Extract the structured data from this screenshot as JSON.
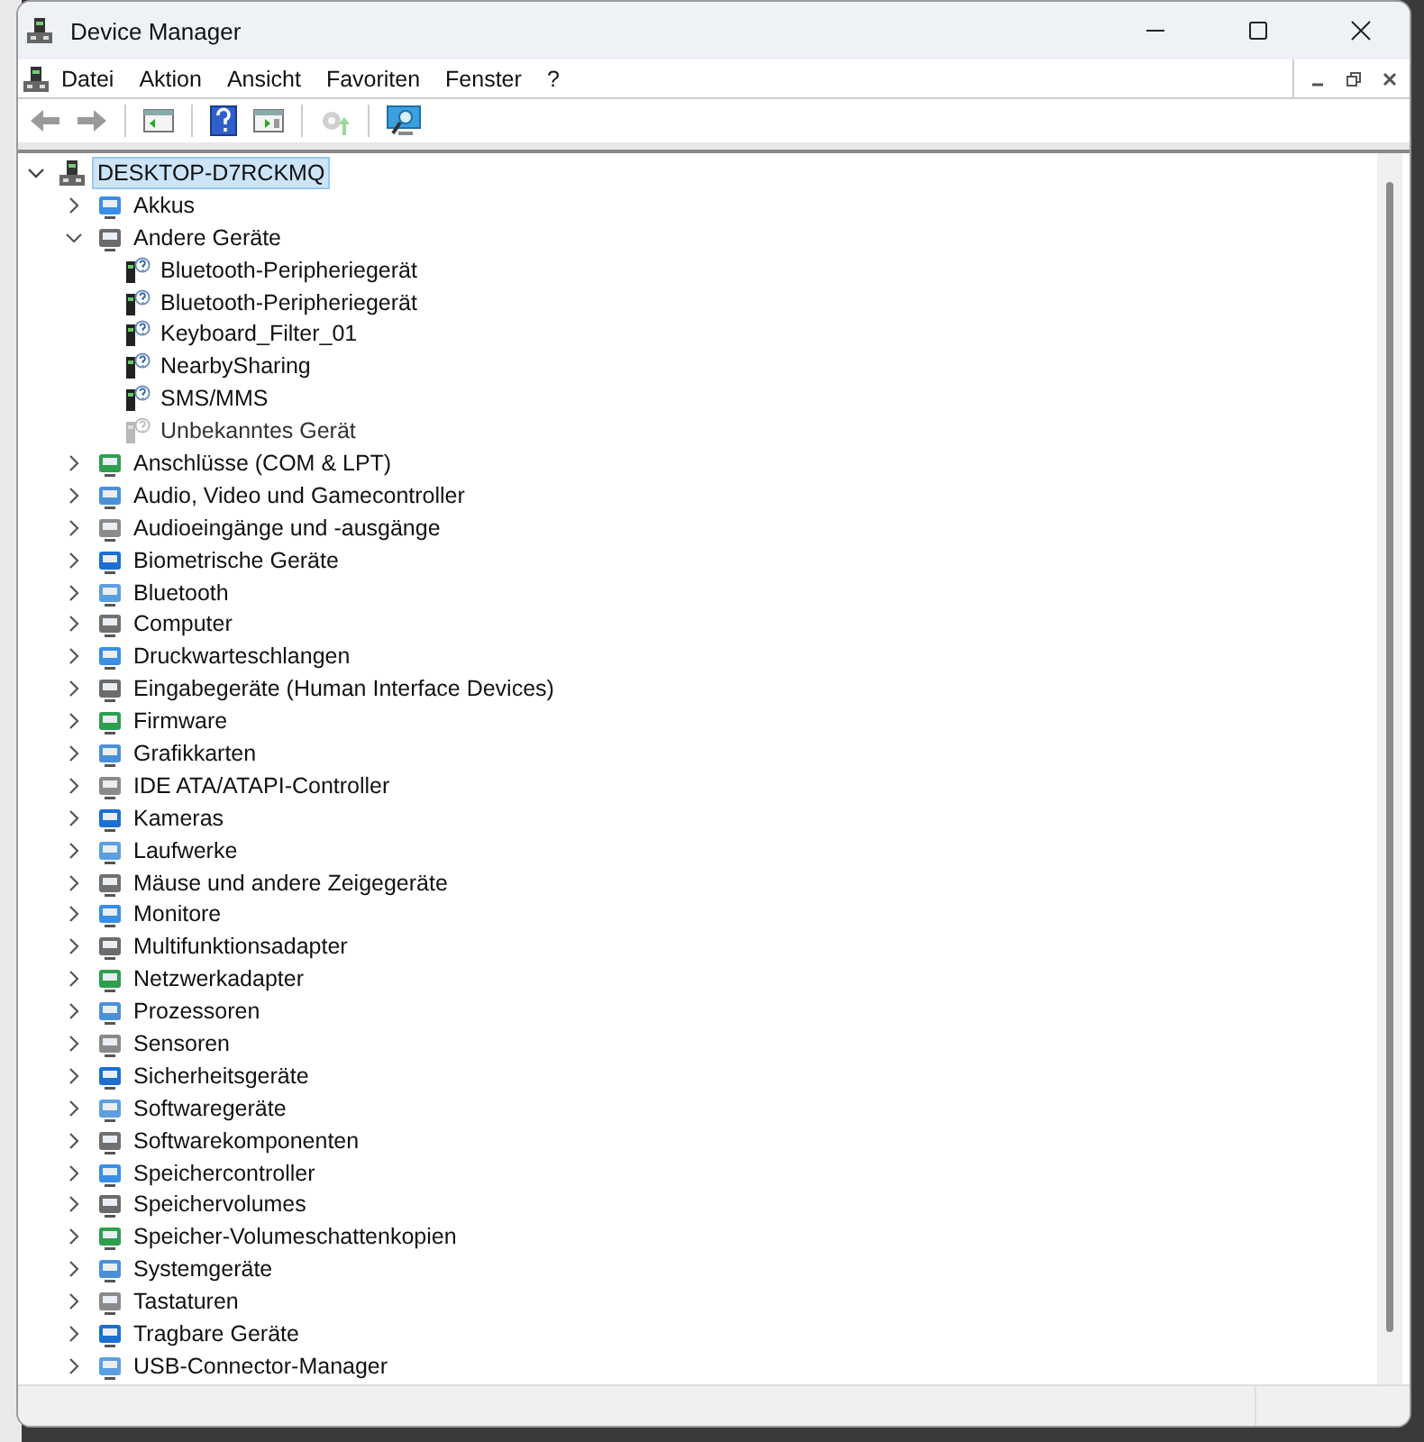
{
  "window": {
    "title": "Device Manager"
  },
  "menu": [
    {
      "label": "Datei"
    },
    {
      "label": "Aktion"
    },
    {
      "label": "Ansicht"
    },
    {
      "label": "Favoriten"
    },
    {
      "label": "Fenster"
    },
    {
      "label": "?"
    }
  ],
  "toolbar": [
    {
      "kind": "back",
      "disabled": true
    },
    {
      "kind": "forward",
      "disabled": true
    },
    {
      "kind": "panel",
      "disabled": false
    },
    {
      "kind": "help",
      "disabled": false
    },
    {
      "kind": "properties",
      "disabled": false
    },
    {
      "kind": "update",
      "disabled": true
    },
    {
      "kind": "scan",
      "disabled": false
    }
  ],
  "tree": {
    "label": "DESKTOP-D7RCKMQ",
    "expanded": true,
    "selected": true,
    "children": [
      {
        "label": "Akkus",
        "expanded": false
      },
      {
        "label": "Andere Geräte",
        "expanded": true,
        "children": [
          {
            "label": "Bluetooth-Peripheriegerät",
            "disabled": false
          },
          {
            "label": "Bluetooth-Peripheriegerät",
            "disabled": false
          },
          {
            "label": "Keyboard_Filter_01",
            "disabled": false
          },
          {
            "label": "NearbySharing",
            "disabled": false
          },
          {
            "label": "SMS/MMS",
            "disabled": false
          },
          {
            "label": "Unbekanntes Gerät",
            "disabled": true
          }
        ]
      },
      {
        "label": "Anschlüsse (COM & LPT)",
        "expanded": false
      },
      {
        "label": "Audio, Video und Gamecontroller",
        "expanded": false
      },
      {
        "label": "Audioeingänge und -ausgänge",
        "expanded": false
      },
      {
        "label": "Biometrische Geräte",
        "expanded": false
      },
      {
        "label": "Bluetooth",
        "expanded": false
      },
      {
        "label": "Computer",
        "expanded": false
      },
      {
        "label": "Druckwarteschlangen",
        "expanded": false
      },
      {
        "label": "Eingabegeräte (Human Interface Devices)",
        "expanded": false
      },
      {
        "label": "Firmware",
        "expanded": false
      },
      {
        "label": "Grafikkarten",
        "expanded": false
      },
      {
        "label": "IDE ATA/ATAPI-Controller",
        "expanded": false
      },
      {
        "label": "Kameras",
        "expanded": false
      },
      {
        "label": "Laufwerke",
        "expanded": false
      },
      {
        "label": "Mäuse und andere Zeigegeräte",
        "expanded": false
      },
      {
        "label": "Monitore",
        "expanded": false
      },
      {
        "label": "Multifunktionsadapter",
        "expanded": false
      },
      {
        "label": "Netzwerkadapter",
        "expanded": false
      },
      {
        "label": "Prozessoren",
        "expanded": false
      },
      {
        "label": "Sensoren",
        "expanded": false
      },
      {
        "label": "Sicherheitsgeräte",
        "expanded": false
      },
      {
        "label": "Softwaregeräte",
        "expanded": false
      },
      {
        "label": "Softwarekomponenten",
        "expanded": false
      },
      {
        "label": "Speichercontroller",
        "expanded": false
      },
      {
        "label": "Speichervolumes",
        "expanded": false
      },
      {
        "label": "Speicher-Volumeschattenkopien",
        "expanded": false
      },
      {
        "label": "Systemgeräte",
        "expanded": false
      },
      {
        "label": "Tastaturen",
        "expanded": false
      },
      {
        "label": "Tragbare Geräte",
        "expanded": false
      },
      {
        "label": "USB-Connector-Manager",
        "expanded": false
      }
    ]
  }
}
